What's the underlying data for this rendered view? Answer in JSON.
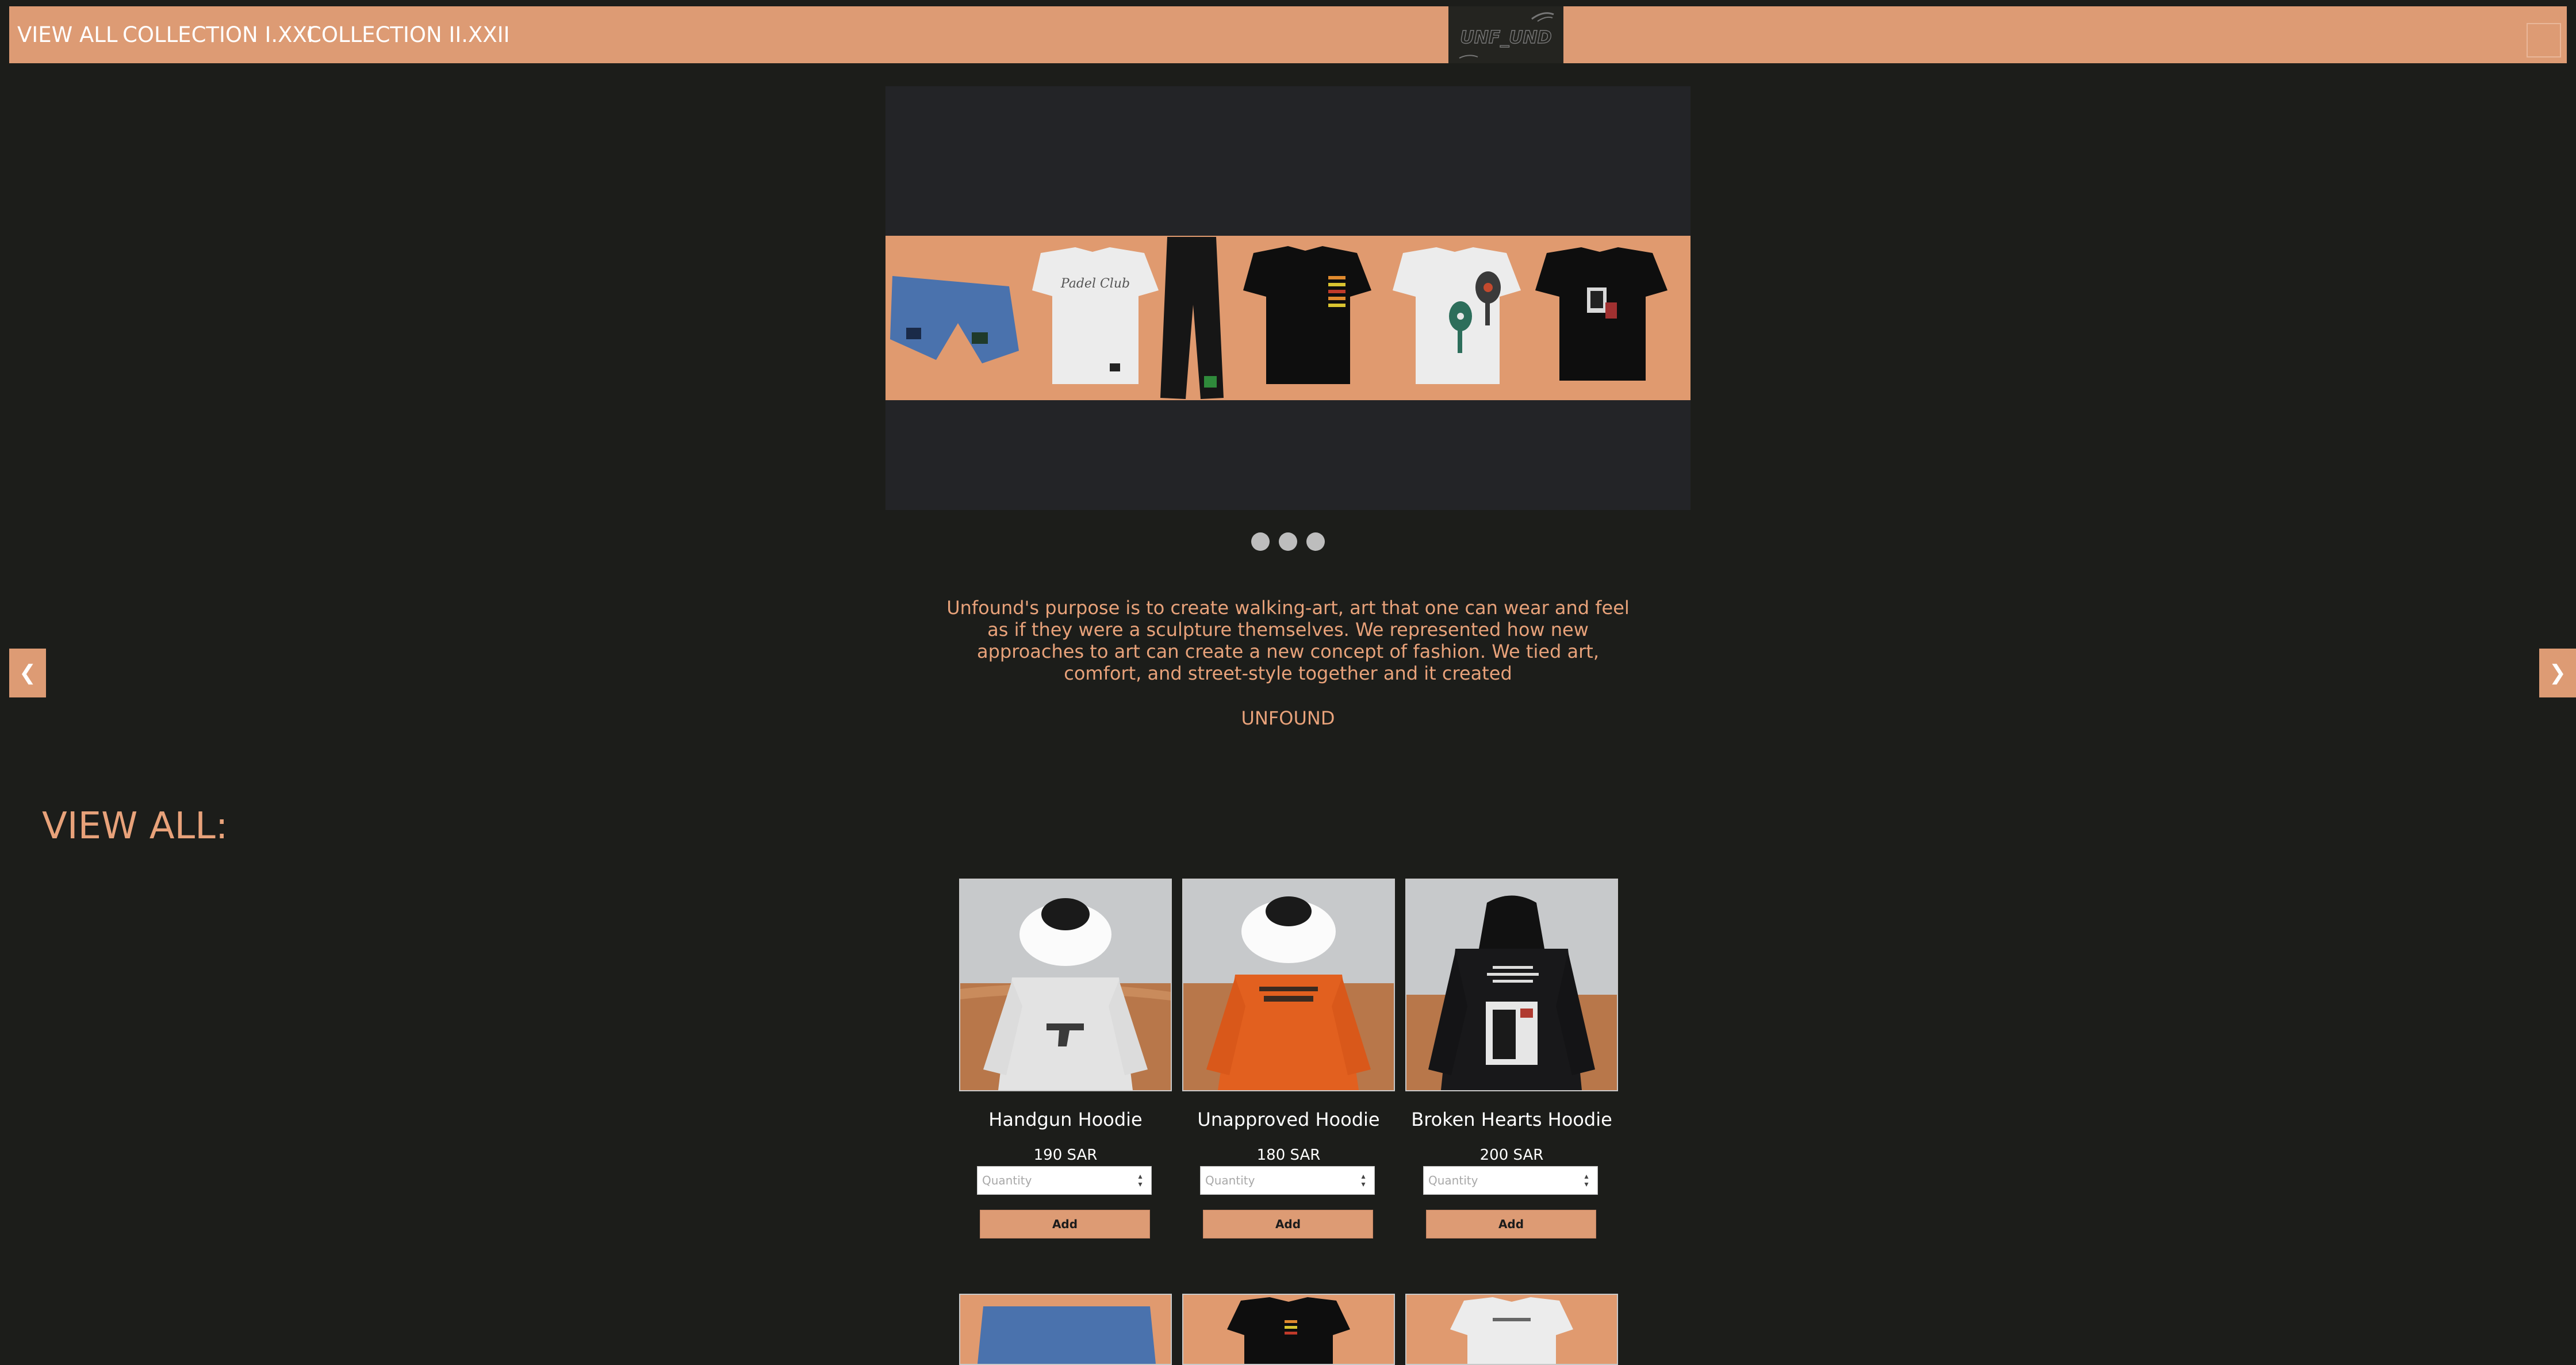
{
  "nav": {
    "links": [
      "VIEW ALL",
      "COLLECTION I.XXI",
      "COLLECTION II.XXII"
    ],
    "logo_text": "UNF_UND"
  },
  "colors": {
    "accent": "#dd9b74",
    "background": "#1c1d1a",
    "hero_background": "#232427",
    "text_accent": "#e8a27a"
  },
  "hero": {
    "slide_count": 3,
    "active_slide": 1,
    "prev_arrow": "❮",
    "next_arrow": "❯",
    "print_text": "Padel Club"
  },
  "mission": {
    "text": "Unfound's purpose is to create walking-art, art that one can wear and feel as if they were a sculpture themselves. We represented how new approaches to art can create a new concept of fashion. We tied art, comfort, and street-style together and it created",
    "brand": "UNFOUND"
  },
  "section": {
    "title": "VIEW ALL:"
  },
  "products": [
    {
      "name": "Handgun Hoodie",
      "price": "190 SAR",
      "placeholder": "Quantity",
      "button": "Add",
      "color": "#dcdcdc"
    },
    {
      "name": "Unapproved Hoodie",
      "price": "180 SAR",
      "placeholder": "Quantity",
      "button": "Add",
      "color": "#e2601f"
    },
    {
      "name": "Broken Hearts Hoodie",
      "price": "200 SAR",
      "placeholder": "Quantity",
      "button": "Add",
      "color": "#18181a"
    }
  ]
}
